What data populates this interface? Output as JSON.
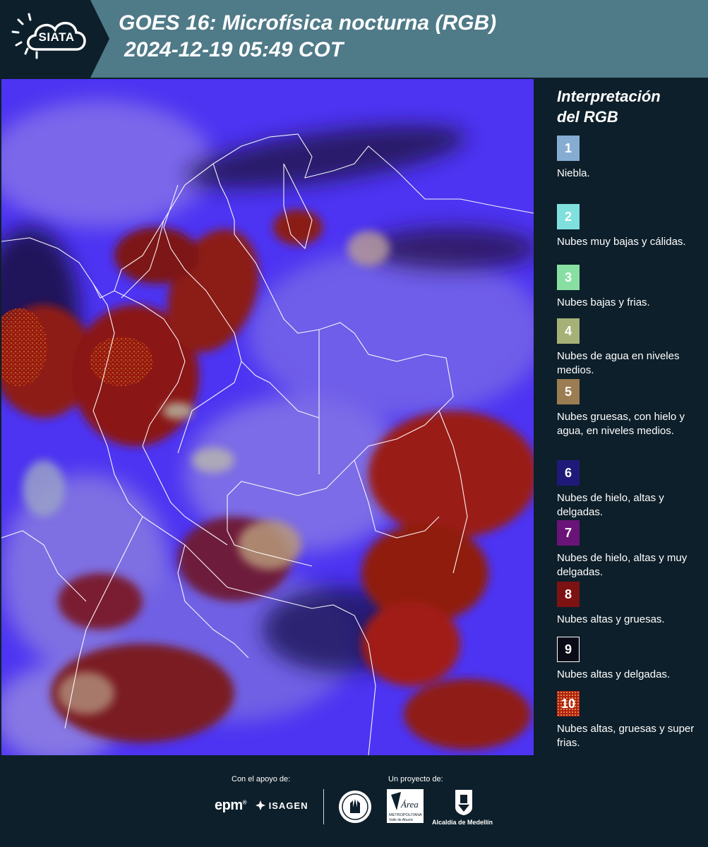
{
  "header": {
    "logo_text": "SIATA",
    "title_line1": "GOES 16: Microfísica nocturna (RGB)",
    "title_line2": "2024-12-19 05:49 COT"
  },
  "legend": {
    "title_line1": "Interpretación",
    "title_line2": "del RGB",
    "items": [
      {
        "number": "1",
        "label": "Niebla.",
        "color": "#86acd2"
      },
      {
        "number": "2",
        "label": "Nubes muy bajas y cálidas.",
        "color": "#7fe0dd"
      },
      {
        "number": "3",
        "label": "Nubes bajas y frias.",
        "color": "#87e0a2"
      },
      {
        "number": "4",
        "label": "Nubes de agua en niveles medios.",
        "color": "#a6b177"
      },
      {
        "number": "5",
        "label": "Nubes gruesas, con hielo y agua, en niveles medios.",
        "color": "#9c7c52"
      },
      {
        "number": "6",
        "label": "Nubes de hielo, altas y delgadas.",
        "color": "#1f1a7a"
      },
      {
        "number": "7",
        "label": "Nubes de hielo, altas y muy delgadas.",
        "color": "#6a1378"
      },
      {
        "number": "8",
        "label": "Nubes altas y gruesas.",
        "color": "#7d1212"
      },
      {
        "number": "9",
        "label": "Nubes altas y delgadas.",
        "color": "#0b0b18"
      },
      {
        "number": "10",
        "label": "Nubes altas, gruesas y super frias.",
        "color": "#b3200f"
      }
    ]
  },
  "footer": {
    "support_label": "Con el apoyo de:",
    "project_label": "Un proyecto de:",
    "epm_text": "epm",
    "isagen_text": "ISAGEN",
    "amva_text": "Área",
    "amva_sub1": "METROPOLITANA",
    "amva_sub2": "Valle de Aburrá",
    "alcaldia_text": "Alcaldía de Medellín"
  }
}
